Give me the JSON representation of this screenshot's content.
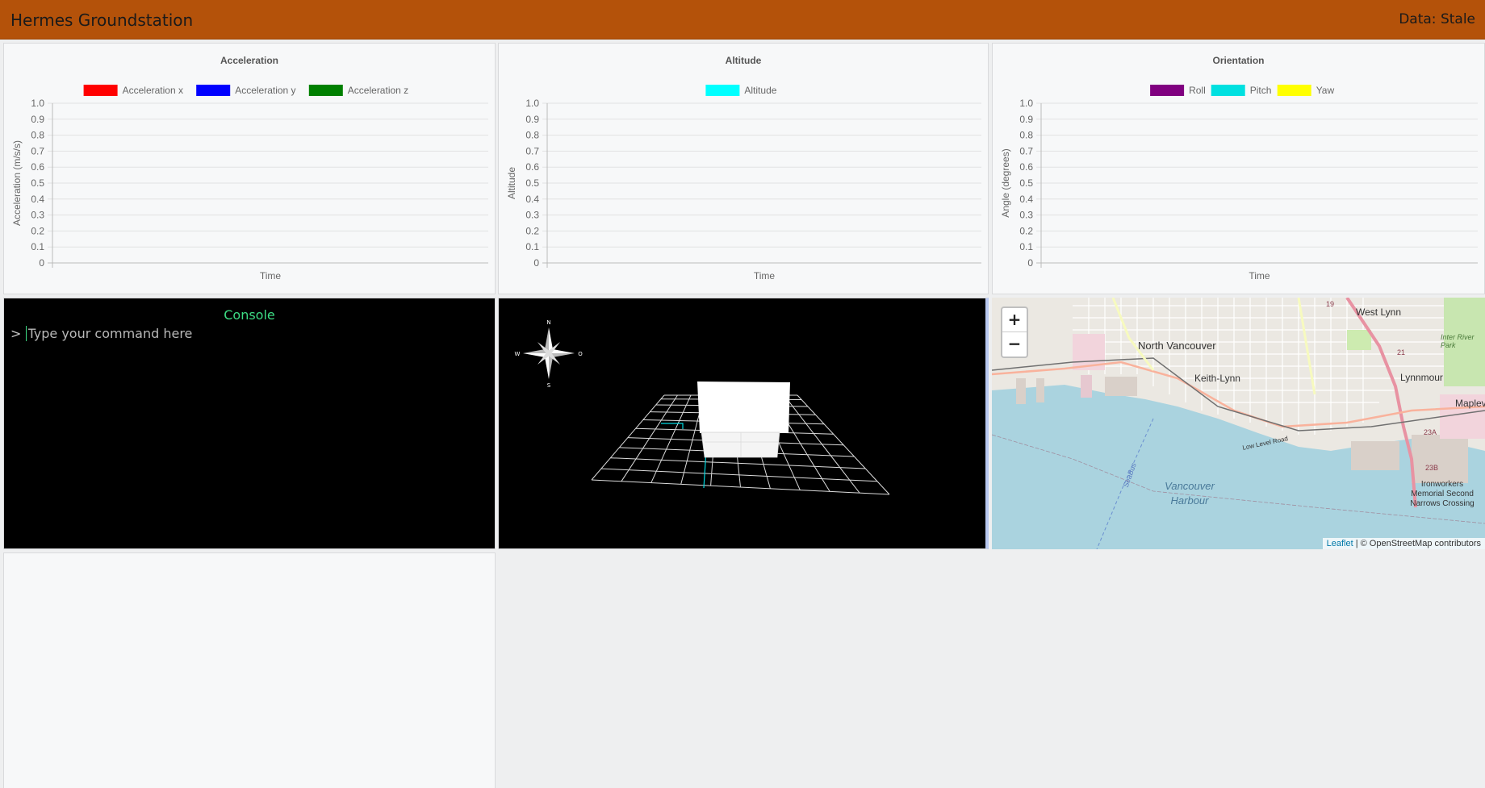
{
  "header": {
    "title": "Hermes Groundstation",
    "status": "Data: Stale"
  },
  "charts": {
    "acceleration": {
      "title": "Acceleration",
      "xlabel": "Time",
      "ylabel": "Acceleration (m/s/s)",
      "legend": [
        {
          "label": "Acceleration x",
          "color": "#ff0000"
        },
        {
          "label": "Acceleration y",
          "color": "#0000ff"
        },
        {
          "label": "Acceleration z",
          "color": "#008000"
        }
      ]
    },
    "altitude": {
      "title": "Altitude",
      "xlabel": "Time",
      "ylabel": "Altitude",
      "legend": [
        {
          "label": "Altitude",
          "color": "#00ffff"
        }
      ]
    },
    "orientation": {
      "title": "Orientation",
      "xlabel": "Time",
      "ylabel": "Angle (degrees)",
      "legend": [
        {
          "label": "Roll",
          "color": "#800080"
        },
        {
          "label": "Pitch",
          "color": "#00e0e0"
        },
        {
          "label": "Yaw",
          "color": "#ffff00"
        }
      ]
    }
  },
  "chart_data": [
    {
      "type": "line",
      "title": "Acceleration",
      "xlabel": "Time",
      "ylabel": "Acceleration (m/s/s)",
      "ylim": [
        0,
        1.0
      ],
      "yticks": [
        "0",
        "0.1",
        "0.2",
        "0.3",
        "0.4",
        "0.5",
        "0.6",
        "0.7",
        "0.8",
        "0.9",
        "1.0"
      ],
      "grid": true,
      "legend": "top",
      "series": [
        {
          "name": "Acceleration x",
          "values": []
        },
        {
          "name": "Acceleration y",
          "values": []
        },
        {
          "name": "Acceleration z",
          "values": []
        }
      ]
    },
    {
      "type": "line",
      "title": "Altitude",
      "xlabel": "Time",
      "ylabel": "Altitude",
      "ylim": [
        0,
        1.0
      ],
      "yticks": [
        "0",
        "0.1",
        "0.2",
        "0.3",
        "0.4",
        "0.5",
        "0.6",
        "0.7",
        "0.8",
        "0.9",
        "1.0"
      ],
      "grid": true,
      "legend": "top",
      "series": [
        {
          "name": "Altitude",
          "values": []
        }
      ]
    },
    {
      "type": "line",
      "title": "Orientation",
      "xlabel": "Time",
      "ylabel": "Angle (degrees)",
      "ylim": [
        0,
        1.0
      ],
      "yticks": [
        "0",
        "0.1",
        "0.2",
        "0.3",
        "0.4",
        "0.5",
        "0.6",
        "0.7",
        "0.8",
        "0.9",
        "1.0"
      ],
      "grid": true,
      "legend": "top",
      "series": [
        {
          "name": "Roll",
          "values": []
        },
        {
          "name": "Pitch",
          "values": []
        },
        {
          "name": "Yaw",
          "values": []
        }
      ]
    }
  ],
  "console": {
    "title": "Console",
    "prompt": ">",
    "placeholder": "Type your command here"
  },
  "compass": {
    "n": "N",
    "s": "S",
    "w": "W",
    "e": "O"
  },
  "map": {
    "zoom_in": "+",
    "zoom_out": "−",
    "attribution_link": "Leaflet",
    "attribution_text": " | © OpenStreetMap contributors",
    "labels": [
      "West Lynn",
      "North Vancouver",
      "Keith-Lynn",
      "Lynnmour",
      "Maplev",
      "Inter River Park",
      "Vancouver Harbour",
      "Ironworkers Memorial Second Narrows Crossing",
      "SeaBus",
      "Low Level Road",
      "19",
      "21",
      "23A",
      "23B"
    ]
  }
}
